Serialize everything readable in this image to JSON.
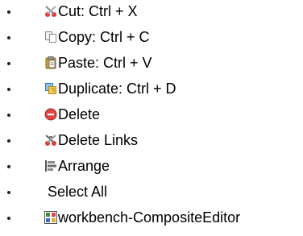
{
  "menu": {
    "items": [
      {
        "label": "Cut: Ctrl + X",
        "icon": "scissors-icon"
      },
      {
        "label": "Copy: Ctrl + C",
        "icon": "copy-icon"
      },
      {
        "label": "Paste: Ctrl + V",
        "icon": "paste-clipboard-icon"
      },
      {
        "label": "Duplicate: Ctrl + D",
        "icon": "duplicate-icon"
      },
      {
        "label": "Delete",
        "icon": "delete-icon"
      },
      {
        "label": "Delete Links",
        "icon": "delete-links-icon"
      },
      {
        "label": "Arrange",
        "icon": "arrange-icon"
      },
      {
        "label": "Select All",
        "icon": ""
      },
      {
        "label": "workbench-CompositeEditor",
        "icon": "composite-editor-icon"
      }
    ]
  }
}
